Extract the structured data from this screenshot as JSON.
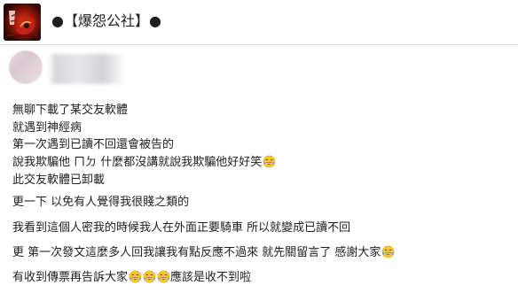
{
  "header": {
    "title": "●【爆怨公社】●"
  },
  "post": {
    "lines": [
      "無聊下載了某交友軟體",
      "就遇到神經病",
      "第一次遇到已讀不回還會被告的",
      "說我欺騙他 ㄇㄉ 什麼都沒講就說我欺騙他好好笑",
      "此交友軟體已卸載",
      "更一下 以免有人覺得我很賤之類的",
      "我看到這個人密我的時候我人在外面正要騎車 所以就變成已讀不回",
      "更 第一次發文這麼多人回我讓我有點反應不過來 就先關留言了 感謝大家",
      "有收到傳票再告訴大家",
      "應該是收不到啦"
    ],
    "emoji_name": "tears-of-joy-emoji"
  }
}
